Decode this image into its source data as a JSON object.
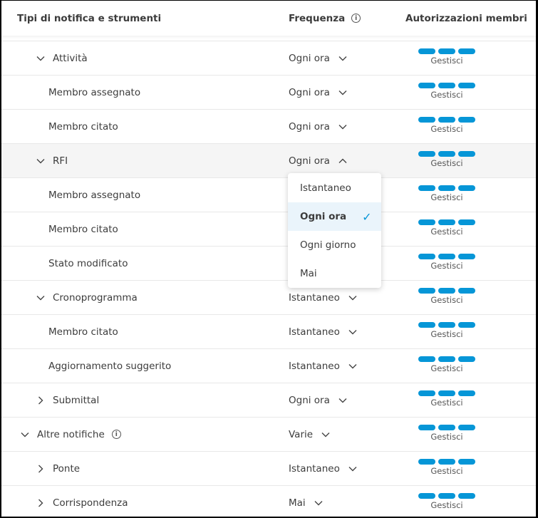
{
  "header": {
    "col_type": "Tipi di notifica e strumenti",
    "col_freq": "Frequenza",
    "col_perm": "Autorizzazioni membri"
  },
  "rows": [
    {
      "label": "Attività",
      "level": 1,
      "chevron": "down",
      "freq": "Ogni ora",
      "perm": "Gestisci"
    },
    {
      "label": "Membro assegnato",
      "level": 2,
      "chevron": "",
      "freq": "Ogni ora",
      "perm": "Gestisci"
    },
    {
      "label": "Membro citato",
      "level": 2,
      "chevron": "",
      "freq": "Ogni ora",
      "perm": "Gestisci"
    },
    {
      "label": "RFI",
      "level": 1,
      "chevron": "down",
      "freq": "Ogni ora",
      "perm": "Gestisci",
      "open": true
    },
    {
      "label": "Membro assegnato",
      "level": 2,
      "chevron": "",
      "freq": "",
      "perm": "Gestisci"
    },
    {
      "label": "Membro citato",
      "level": 2,
      "chevron": "",
      "freq": "",
      "perm": "Gestisci"
    },
    {
      "label": "Stato modificato",
      "level": 2,
      "chevron": "",
      "freq": "",
      "perm": "Gestisci"
    },
    {
      "label": "Cronoprogramma",
      "level": 1,
      "chevron": "down",
      "freq": "Istantaneo",
      "perm": "Gestisci"
    },
    {
      "label": "Membro citato",
      "level": 2,
      "chevron": "",
      "freq": "Istantaneo",
      "perm": "Gestisci"
    },
    {
      "label": "Aggiornamento suggerito",
      "level": 2,
      "chevron": "",
      "freq": "Istantaneo",
      "perm": "Gestisci"
    },
    {
      "label": "Submittal",
      "level": 1,
      "chevron": "right",
      "freq": "Ogni ora",
      "perm": "Gestisci"
    },
    {
      "label": "Altre notifiche",
      "level": 0,
      "chevron": "down",
      "freq": "Varie",
      "perm": "Gestisci",
      "info": true
    },
    {
      "label": "Ponte",
      "level": 1,
      "chevron": "right",
      "freq": "Istantaneo",
      "perm": "Gestisci"
    },
    {
      "label": "Corrispondenza",
      "level": 1,
      "chevron": "right",
      "freq": "Mai",
      "perm": "Gestisci"
    }
  ],
  "dropdown": {
    "options": [
      "Istantaneo",
      "Ogni ora",
      "Ogni giorno",
      "Mai"
    ],
    "selected": "Ogni ora"
  },
  "colors": {
    "accent": "#0696d7",
    "highlight": "#eaf4fb"
  }
}
